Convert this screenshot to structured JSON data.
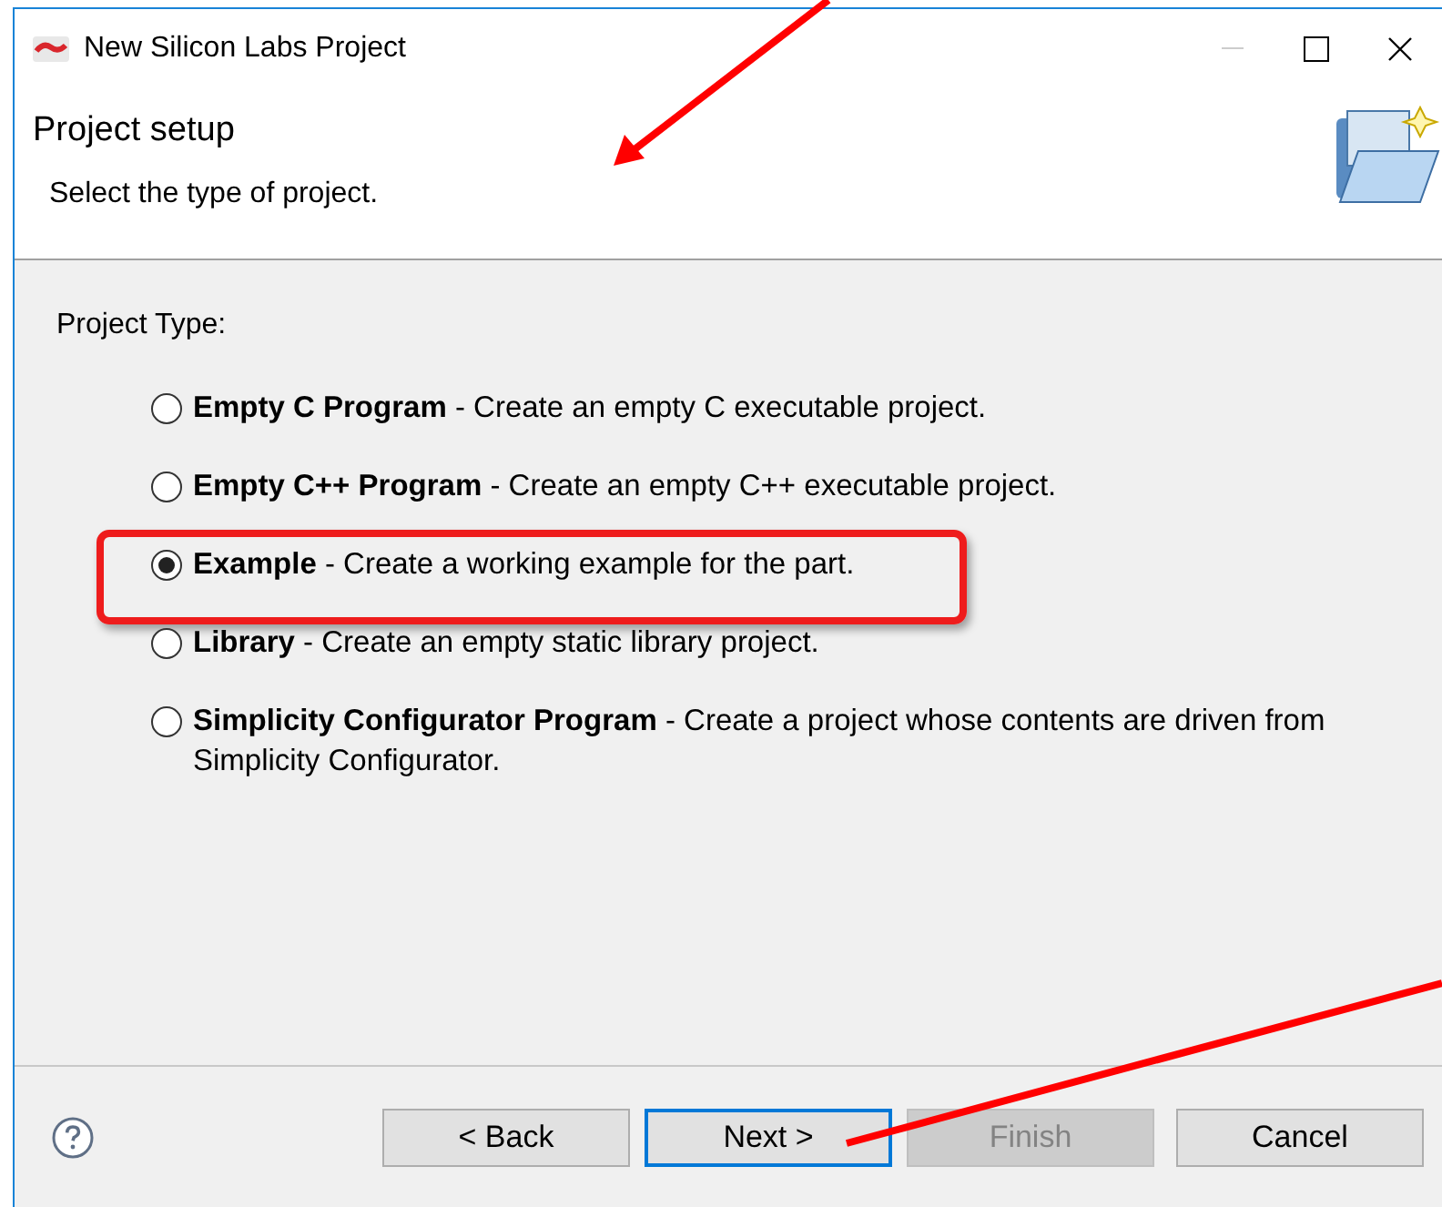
{
  "window": {
    "title": "New Silicon Labs Project"
  },
  "header": {
    "title": "Project setup",
    "subtitle": "Select the type of project."
  },
  "group_label": "Project Type:",
  "options": [
    {
      "text": "**Empty C Program** - Create an empty C executable project.",
      "selected": false,
      "highlighted": false
    },
    {
      "text": "**Empty C++ Program** - Create an empty C++ executable project.",
      "selected": false,
      "highlighted": false
    },
    {
      "text": "**Example** - Create a working example for the part.",
      "selected": true,
      "highlighted": true
    },
    {
      "text": "**Library** - Create an empty static library project.",
      "selected": false,
      "highlighted": false
    },
    {
      "text": "**Simplicity Configurator Program** - Create a project whose contents are driven from Simplicity Configurator.",
      "selected": false,
      "highlighted": false
    }
  ],
  "buttons": [
    {
      "label": "< Back",
      "disabled": false,
      "focused": false
    },
    {
      "label": "Next >",
      "disabled": false,
      "focused": true
    },
    {
      "label": "Finish",
      "disabled": true,
      "focused": false
    },
    {
      "label": "Cancel",
      "disabled": false,
      "focused": false
    }
  ]
}
